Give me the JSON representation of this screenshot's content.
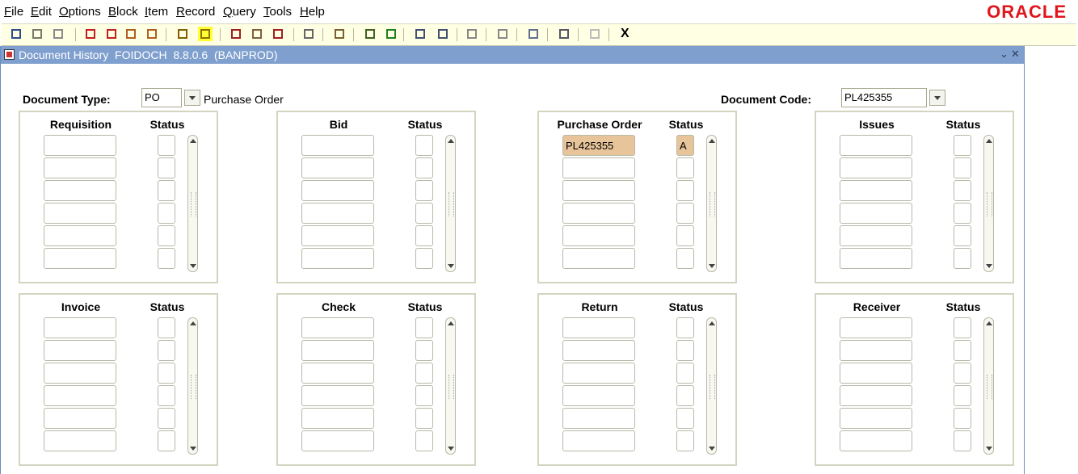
{
  "menu": [
    {
      "key": "F",
      "rest": "ile"
    },
    {
      "key": "E",
      "rest": "dit"
    },
    {
      "key": "O",
      "rest": "ptions"
    },
    {
      "key": "B",
      "rest": "lock"
    },
    {
      "key": "I",
      "rest": "tem"
    },
    {
      "key": "R",
      "rest": "ecord"
    },
    {
      "key": "Q",
      "rest": "uery"
    },
    {
      "key": "T",
      "rest": "ools"
    },
    {
      "key": "H",
      "rest": "elp"
    }
  ],
  "brand": "ORACLE",
  "toolbar": {
    "close_label": "X",
    "icons": [
      "save-icon",
      "rollback-icon",
      "print-doc-icon",
      "insert-record-icon",
      "remove-record-icon",
      "previous-block-icon",
      "next-block-icon",
      "enter-query-icon",
      "execute-query-icon",
      "cancel-query-icon",
      "count-query-icon",
      "clear-record-icon",
      "clear-form-icon",
      "print-icon",
      "search-icon",
      "add-icon",
      "expand-icon",
      "collapse-icon",
      "speaker-icon",
      "target-icon",
      "export-icon",
      "help-icon",
      "bulb-icon"
    ],
    "highlighted": "execute-query-icon"
  },
  "window": {
    "title": "Document History  FOIDOCH  8.8.0.6  (BANPROD)",
    "minimize": "⌄",
    "close": "✕"
  },
  "header": {
    "doc_type_label": "Document Type:",
    "doc_type_value": "PO",
    "doc_type_desc": "Purchase Order",
    "doc_code_label": "Document Code:",
    "doc_code_value": "PL425355"
  },
  "groups": [
    {
      "name": "Requisition",
      "status_label": "Status",
      "rows": [
        [
          "",
          ""
        ],
        [
          "",
          ""
        ],
        [
          "",
          ""
        ],
        [
          "",
          ""
        ],
        [
          "",
          ""
        ],
        [
          "",
          ""
        ]
      ]
    },
    {
      "name": "Bid",
      "status_label": "Status",
      "rows": [
        [
          "",
          ""
        ],
        [
          "",
          ""
        ],
        [
          "",
          ""
        ],
        [
          "",
          ""
        ],
        [
          "",
          ""
        ],
        [
          "",
          ""
        ]
      ]
    },
    {
      "name": "Purchase Order",
      "status_label": "Status",
      "rows": [
        [
          "PL425355",
          "A"
        ],
        [
          "",
          ""
        ],
        [
          "",
          ""
        ],
        [
          "",
          ""
        ],
        [
          "",
          ""
        ],
        [
          "",
          ""
        ]
      ]
    },
    {
      "name": "Issues",
      "status_label": "Status",
      "rows": [
        [
          "",
          ""
        ],
        [
          "",
          ""
        ],
        [
          "",
          ""
        ],
        [
          "",
          ""
        ],
        [
          "",
          ""
        ],
        [
          "",
          ""
        ]
      ]
    },
    {
      "name": "Invoice",
      "status_label": "Status",
      "rows": [
        [
          "",
          ""
        ],
        [
          "",
          ""
        ],
        [
          "",
          ""
        ],
        [
          "",
          ""
        ],
        [
          "",
          ""
        ],
        [
          "",
          ""
        ]
      ]
    },
    {
      "name": "Check",
      "status_label": "Status",
      "rows": [
        [
          "",
          ""
        ],
        [
          "",
          ""
        ],
        [
          "",
          ""
        ],
        [
          "",
          ""
        ],
        [
          "",
          ""
        ],
        [
          "",
          ""
        ]
      ]
    },
    {
      "name": "Return",
      "status_label": "Status",
      "rows": [
        [
          "",
          ""
        ],
        [
          "",
          ""
        ],
        [
          "",
          ""
        ],
        [
          "",
          ""
        ],
        [
          "",
          ""
        ],
        [
          "",
          ""
        ]
      ]
    },
    {
      "name": "Receiver",
      "status_label": "Status",
      "rows": [
        [
          "",
          ""
        ],
        [
          "",
          ""
        ],
        [
          "",
          ""
        ],
        [
          "",
          ""
        ],
        [
          "",
          ""
        ],
        [
          "",
          ""
        ]
      ]
    }
  ],
  "colors": {
    "title_bar": "#7f9fce",
    "toolbar_bg": "#ffffe4",
    "filled_cell": "#e8c49a",
    "brand": "#e0161e",
    "toolbar_highlight": "#ffff33"
  }
}
